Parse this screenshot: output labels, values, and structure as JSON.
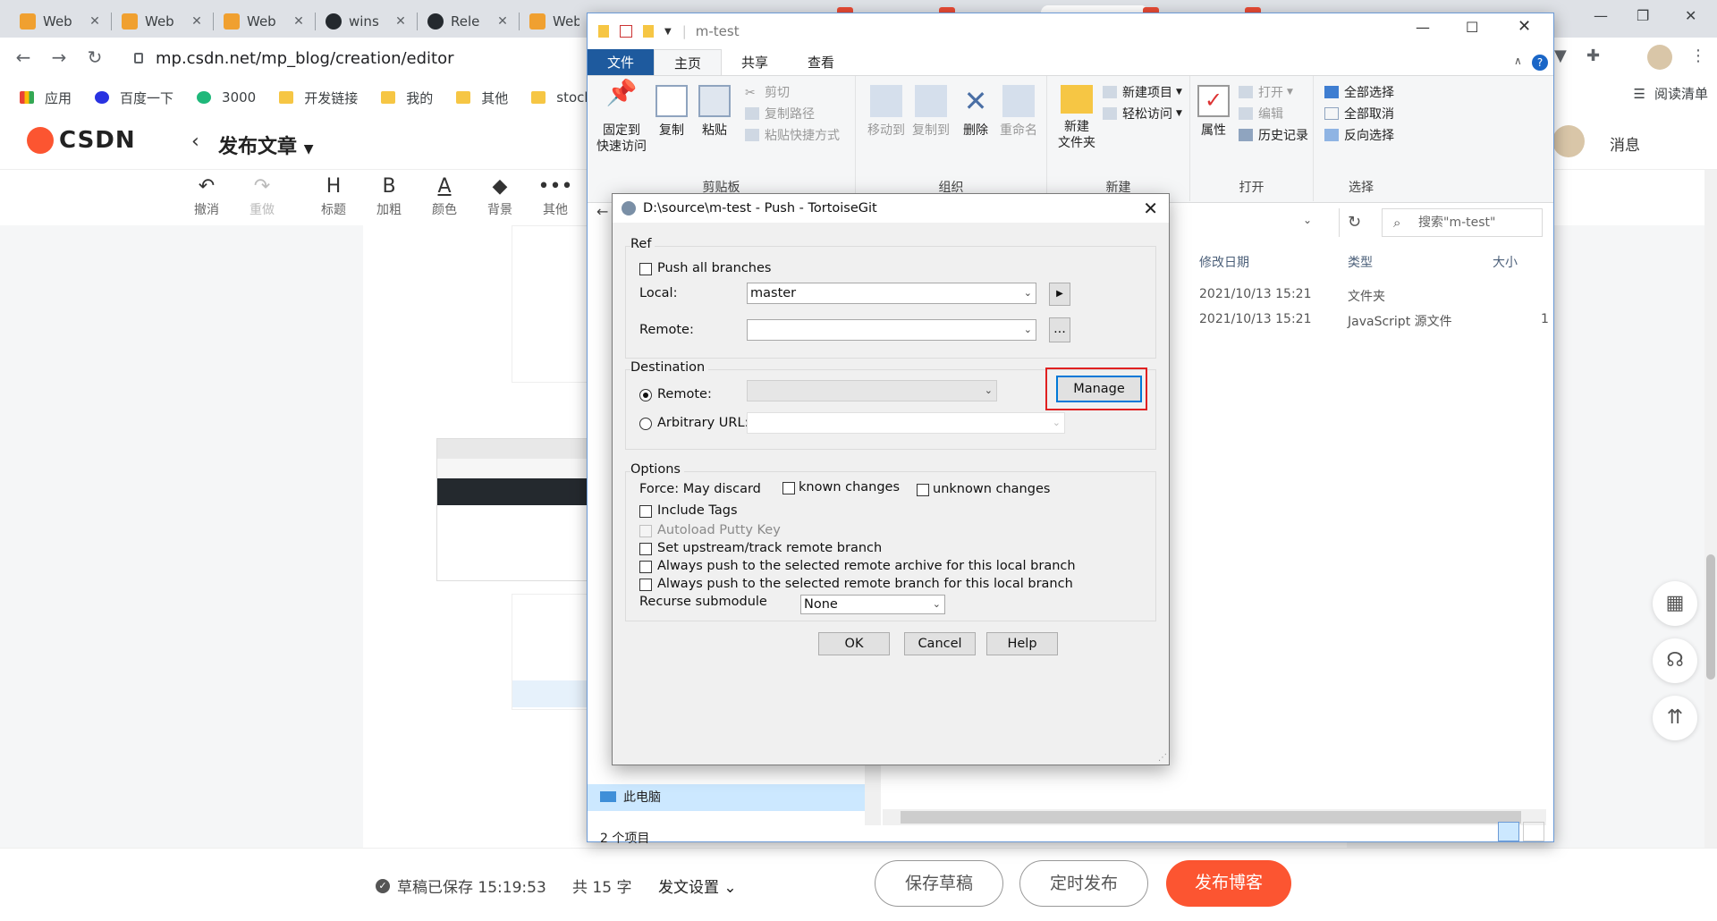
{
  "browser": {
    "tabs": [
      {
        "label": "Web",
        "color": "#f0a030"
      },
      {
        "label": "Web",
        "color": "#f0a030"
      },
      {
        "label": "Web",
        "color": "#f0a030"
      },
      {
        "label": "wins",
        "color": "#24292e"
      },
      {
        "label": "Rele",
        "color": "#24292e"
      },
      {
        "label": "Web",
        "color": "#f0a030"
      }
    ],
    "url": "mp.csdn.net/mp_blog/creation/editor",
    "bookmarks": [
      "应用",
      "百度一下",
      "3000",
      "开发链接",
      "我的",
      "其他",
      "stock"
    ],
    "reading_list": "阅读清单"
  },
  "csdn": {
    "logo": "CSDN",
    "page_title": "发布文章",
    "messages": "消息",
    "toolbar": [
      {
        "icon": "↶",
        "label": "撤消"
      },
      {
        "icon": "↷",
        "label": "重做"
      },
      {
        "icon": "H",
        "label": "标题"
      },
      {
        "icon": "B",
        "label": "加粗"
      },
      {
        "icon": "A",
        "label": "颜色"
      },
      {
        "icon": "◆",
        "label": "背景"
      },
      {
        "icon": "•••",
        "label": "其他"
      }
    ],
    "draft_status": "草稿已保存 15:19:53",
    "word_count": "共 15 字",
    "publish_settings": "发文设置",
    "save_draft": "保存草稿",
    "schedule": "定时发布",
    "publish": "发布博客"
  },
  "explorer": {
    "title": "m-test",
    "tabs": [
      "文件",
      "主页",
      "共享",
      "查看"
    ],
    "clipboard": {
      "pin": "固定到\n快速访问",
      "copy": "复制",
      "paste": "粘贴",
      "cut": "剪切",
      "copy_path": "复制路径",
      "paste_shortcut": "粘贴快捷方式",
      "group": "剪贴板"
    },
    "organize": {
      "move_to": "移动到",
      "copy_to": "复制到",
      "delete": "删除",
      "rename": "重命名",
      "group": "组织"
    },
    "new": {
      "new_folder": "新建\n文件夹",
      "new_item": "新建项目",
      "easy_access": "轻松访问",
      "group": "新建"
    },
    "open": {
      "properties": "属性",
      "open": "打开",
      "edit": "编辑",
      "history": "历史记录",
      "group": "打开"
    },
    "select": {
      "select_all": "全部选择",
      "select_none": "全部取消",
      "invert": "反向选择",
      "group": "选择"
    },
    "search_placeholder": "搜索\"m-test\"",
    "columns": {
      "modified": "修改日期",
      "type": "类型",
      "size": "大小"
    },
    "rows": [
      {
        "modified": "2021/10/13 15:21",
        "type": "文件夹",
        "size": ""
      },
      {
        "modified": "2021/10/13 15:21",
        "type": "JavaScript 源文件",
        "size": "1"
      }
    ],
    "nav_selected": "此电脑",
    "status": "2 个项目"
  },
  "dialog": {
    "title": "D:\\source\\m-test - Push - TortoiseGit",
    "ref_group": "Ref",
    "push_all_branches": "Push all branches",
    "local_label": "Local:",
    "local_value": "master",
    "remote_label": "Remote:",
    "remote_value": "",
    "destination_group": "Destination",
    "dest_remote_label": "Remote:",
    "manage": "Manage",
    "arbitrary_url": "Arbitrary URL:",
    "options_group": "Options",
    "force_label": "Force: May discard",
    "known_changes": "known changes",
    "unknown_changes": "unknown changes",
    "include_tags": "Include Tags",
    "autoload_putty": "Autoload Putty Key",
    "set_upstream": "Set upstream/track remote branch",
    "always_archive": "Always push to the selected remote archive for this local branch",
    "always_branch": "Always push to the selected remote branch for this local branch",
    "recurse_label": "Recurse submodule",
    "recurse_value": "None",
    "ok": "OK",
    "cancel": "Cancel",
    "help": "Help",
    "ellipsis": "...",
    "highlight_color": "#e02020"
  }
}
